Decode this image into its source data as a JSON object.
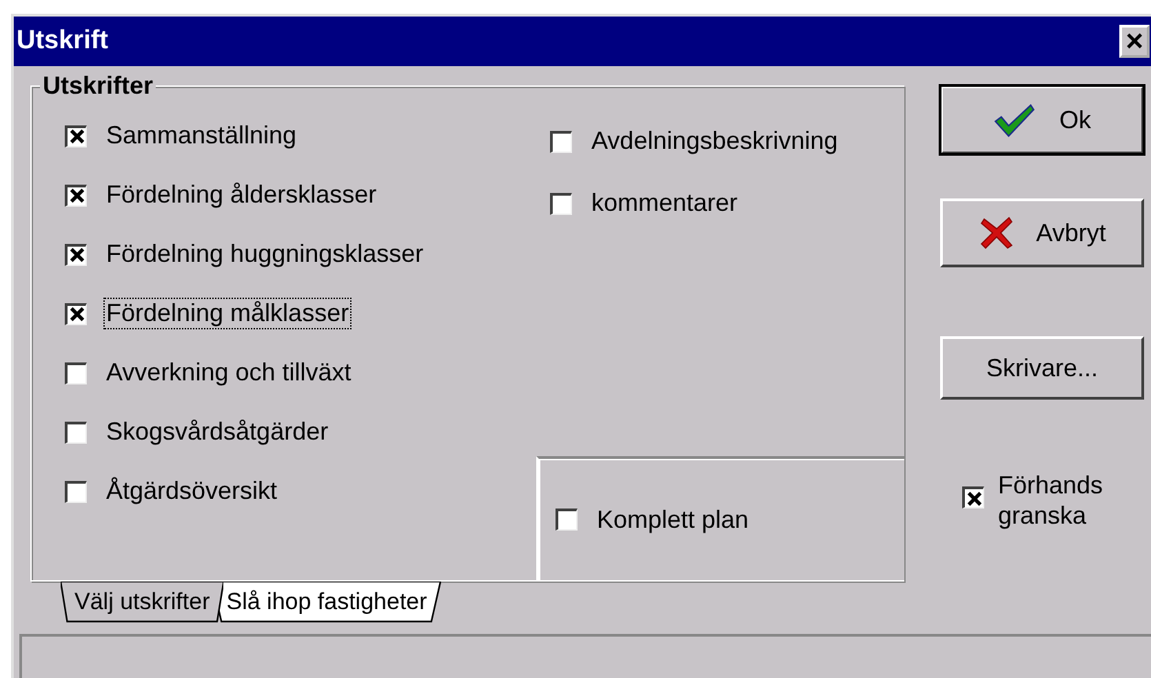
{
  "window": {
    "title": "Utskrift",
    "close": "×"
  },
  "group": {
    "title": "Utskrifter"
  },
  "left_options": [
    {
      "label": "Sammanställning",
      "checked": true,
      "focused": false
    },
    {
      "label": "Fördelning åldersklasser",
      "checked": true,
      "focused": false
    },
    {
      "label": "Fördelning huggningsklasser",
      "checked": true,
      "focused": false
    },
    {
      "label": "Fördelning målklasser",
      "checked": true,
      "focused": true
    },
    {
      "label": "Avverkning och tillväxt",
      "checked": false,
      "focused": false
    },
    {
      "label": "Skogsvårdsåtgärder",
      "checked": false,
      "focused": false
    },
    {
      "label": "Åtgärdsöversikt",
      "checked": false,
      "focused": false
    }
  ],
  "right_options": [
    {
      "label": "Avdelningsbeskrivning",
      "checked": false,
      "focused": false
    },
    {
      "label": "kommentarer",
      "checked": false,
      "focused": false
    }
  ],
  "panel_option": {
    "label": "Komplett plan",
    "checked": false
  },
  "buttons": [
    {
      "label": "Ok",
      "kind": "ok",
      "default": true
    },
    {
      "label": "Avbryt",
      "kind": "cancel",
      "default": false
    },
    {
      "label": "Skrivare...",
      "kind": "plain",
      "default": false
    }
  ],
  "preview": {
    "label": "Förhands granska",
    "checked": true
  },
  "tabs": [
    {
      "label": "Välj utskrifter",
      "selected": true
    },
    {
      "label": "Slå ihop fastigheter",
      "selected": false
    }
  ]
}
